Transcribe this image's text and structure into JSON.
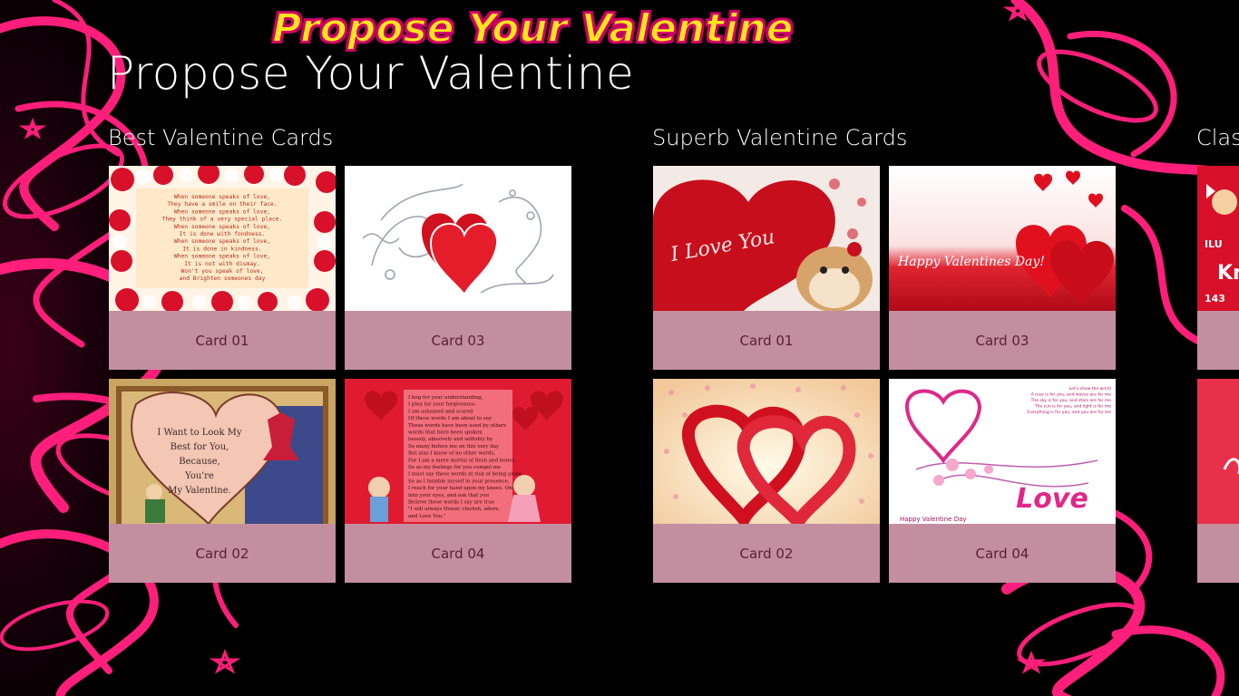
{
  "app": {
    "logo_text": "Propose Your Valentine",
    "page_title": "Propose Your Valentine"
  },
  "groups": [
    {
      "title": "Best Valentine Cards",
      "cards": [
        {
          "label": "Card 01"
        },
        {
          "label": "Card 02"
        },
        {
          "label": "Card 03"
        },
        {
          "label": "Card 04"
        }
      ]
    },
    {
      "title": "Superb Valentine Cards",
      "cards": [
        {
          "label": "Card 01"
        },
        {
          "label": "Card 02"
        },
        {
          "label": "Card 03"
        },
        {
          "label": "Card 04"
        }
      ]
    },
    {
      "title": "Clas"
    }
  ],
  "thumb_text": {
    "b01_poem": [
      "When someone speaks of love,",
      "They have a smile on their face.",
      "When someone speaks of love,",
      "They think of a very special place.",
      "When someone speaks of love,",
      "It is done with fondness.",
      "When someone speaks of love,",
      "It is done in kindness.",
      "When someone speaks of love,",
      "It is not with dismay.",
      "Won't you speak of love,",
      "and Brighten someones day"
    ],
    "b02_lines": [
      "I Want to Look My",
      "Best for You,",
      "Because,",
      "You're",
      "My Valentine."
    ],
    "b04_lines": [
      "I beg for your understanding,",
      "I plea for your forgiveness.",
      "I am ashamed and scared",
      "Of these words I am about to say",
      "These words have been used by others",
      "words that have been spoken",
      "loosely, abusively and selfishly by",
      "So many before me on this very day",
      "But alas I know of no other words,",
      "For I am a mere mortal of flesh and bones.",
      "So as my feelings for you compel me",
      "I must say these words at risk of being alone.",
      "So as I humble myself in your presence,",
      "I reach for your hand upon my knees. Once",
      "into your eyes, and ask that you",
      "Believe these words I say are true",
      "\"I will always Honor, cherish, adore,",
      "and Love You.\""
    ],
    "s01": "I Love You",
    "s03": "Happy Valentines Day!",
    "s04_love": "Love",
    "s04_bottom": "Happy Valentine Day",
    "s04_lines": [
      "Let's show the world",
      "A rose is for you, and waves are for me",
      "The sky is for you, and stars are for me",
      "The sun is for you, and light is for me",
      "Everything is for you, and you are for me"
    ],
    "c01_a": "ILU",
    "c01_b": "Kn",
    "c01_c": "143"
  },
  "colors": {
    "background": "#000000",
    "swirl": "#ff1f7a",
    "tile": "#c38fa0",
    "caption_text": "#5a1e33",
    "logo_fill": "#ffe61a",
    "logo_stroke": "#d4006a"
  }
}
